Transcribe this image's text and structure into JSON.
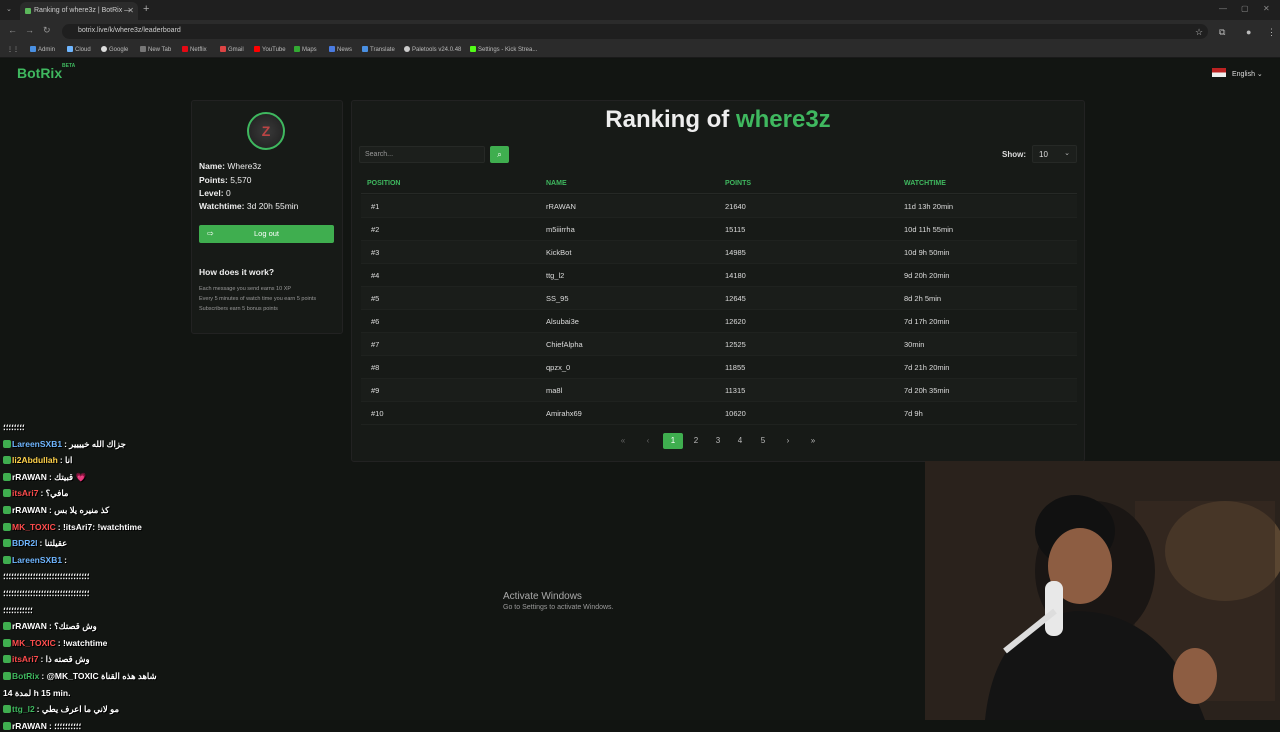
{
  "browser": {
    "tab_title": "Ranking of where3z | BotRix —",
    "url": "botrix.live/k/where3z/leaderboard",
    "bookmarks": [
      "Admin",
      "Cloud",
      "Google",
      "New Tab",
      "Netflix",
      "Gmail",
      "YouTube",
      "Maps",
      "News",
      "Translate",
      "Paletools v24.0.48",
      "Settings - Kick Strea..."
    ]
  },
  "site": {
    "logo": "BotRix",
    "beta": "BETA",
    "language": "English"
  },
  "profile": {
    "name_label": "Name:",
    "name": "Where3z",
    "points_label": "Points:",
    "points": "5,570",
    "level_label": "Level:",
    "level": "0",
    "watchtime_label": "Watchtime:",
    "watchtime": "3d 20h 55min",
    "logout": "Log out",
    "how_title": "How does it work?",
    "how_lines": [
      "Each message you send earns 10 XP",
      "Every 5 minutes of watch time you earn 5 points",
      "Subscribers earn 5 bonus points"
    ]
  },
  "ranking": {
    "title_prefix": "Ranking of",
    "title_channel": "where3z",
    "search_placeholder": "Search...",
    "show_label": "Show:",
    "show_value": "10",
    "columns": [
      "POSITION",
      "NAME",
      "POINTS",
      "WATCHTIME"
    ],
    "rows": [
      {
        "pos": "#1",
        "name": "rRAWAN",
        "points": "21640",
        "watch": "11d 13h 20min"
      },
      {
        "pos": "#2",
        "name": "m5iiirrha",
        "points": "15115",
        "watch": "10d 11h 55min"
      },
      {
        "pos": "#3",
        "name": "KickBot",
        "points": "14985",
        "watch": "10d 9h 50min"
      },
      {
        "pos": "#4",
        "name": "ttg_l2",
        "points": "14180",
        "watch": "9d 20h 20min"
      },
      {
        "pos": "#5",
        "name": "SS_95",
        "points": "12645",
        "watch": "8d 2h 5min"
      },
      {
        "pos": "#6",
        "name": "Alsubai3e",
        "points": "12620",
        "watch": "7d 17h 20min"
      },
      {
        "pos": "#7",
        "name": "ChiefAlpha",
        "points": "12525",
        "watch": "30min"
      },
      {
        "pos": "#8",
        "name": "qpzx_0",
        "points": "11855",
        "watch": "7d 21h 20min"
      },
      {
        "pos": "#9",
        "name": "ma8l",
        "points": "11315",
        "watch": "7d 20h 35min"
      },
      {
        "pos": "#10",
        "name": "Amirahx69",
        "points": "10620",
        "watch": "7d 9h"
      }
    ],
    "pages": [
      "1",
      "2",
      "3",
      "4",
      "5"
    ]
  },
  "windows_watermark": {
    "line1": "Activate Windows",
    "line2": "Go to Settings to activate Windows."
  },
  "chat": [
    {
      "user": "",
      "text": "؛؛؛؛؛؛؛؛",
      "color": "#ffffff"
    },
    {
      "user": "LareenSXB1",
      "text": ": جزاك الله خيييير",
      "color": "#6fb6ff"
    },
    {
      "user": "li2Abdullah",
      "text": ": انا",
      "color": "#ffd24a"
    },
    {
      "user": "rRAWAN",
      "text": ": قبيتك 💗",
      "color": "#ffffff"
    },
    {
      "user": "itsAri7",
      "text": ": مافي؟",
      "color": "#ff4d4d"
    },
    {
      "user": "rRAWAN",
      "text": ": كذ منيره يلا بس",
      "color": "#ffffff"
    },
    {
      "user": "MK_TOXIC",
      "text": ": !itsAri7: !watchtime",
      "color": "#ff4d4d"
    },
    {
      "user": "BDR2l",
      "text": ": عقيلتنا",
      "color": "#6fb6ff"
    },
    {
      "user": "LareenSXB1",
      "text": ":",
      "color": "#6fb6ff"
    },
    {
      "user": "",
      "text": "؛؛؛؛؛؛؛؛؛؛؛؛؛؛؛؛؛؛؛؛؛؛؛؛؛؛؛؛؛؛؛؛",
      "color": "#ffffff"
    },
    {
      "user": "",
      "text": "؛؛؛؛؛؛؛؛؛؛؛؛؛؛؛؛؛؛؛؛؛؛؛؛؛؛؛؛؛؛؛؛",
      "color": "#ffffff"
    },
    {
      "user": "",
      "text": "؛؛؛؛؛؛؛؛؛؛؛",
      "color": "#ffffff"
    },
    {
      "user": "rRAWAN",
      "text": ": وش قصتك؟",
      "color": "#ffffff"
    },
    {
      "user": "MK_TOXIC",
      "text": ": !watchtime",
      "color": "#ff4d4d"
    },
    {
      "user": "itsAri7",
      "text": ": وش قصته ذا",
      "color": "#ff4d4d"
    },
    {
      "user": "BotRix",
      "text": ": @MK_TOXIC شاهد هذه القناة",
      "color": "#3fb85f"
    },
    {
      "user": "",
      "text": "14 لمدة h 15 min.",
      "color": "#ffffff"
    },
    {
      "user": "ttg_l2",
      "text": ": مو لاني ما اعرف يطي",
      "color": "#3fb85f"
    },
    {
      "user": "rRAWAN",
      "text": ": ؛؛؛؛؛؛؛؛؛؛",
      "color": "#ffffff"
    }
  ]
}
